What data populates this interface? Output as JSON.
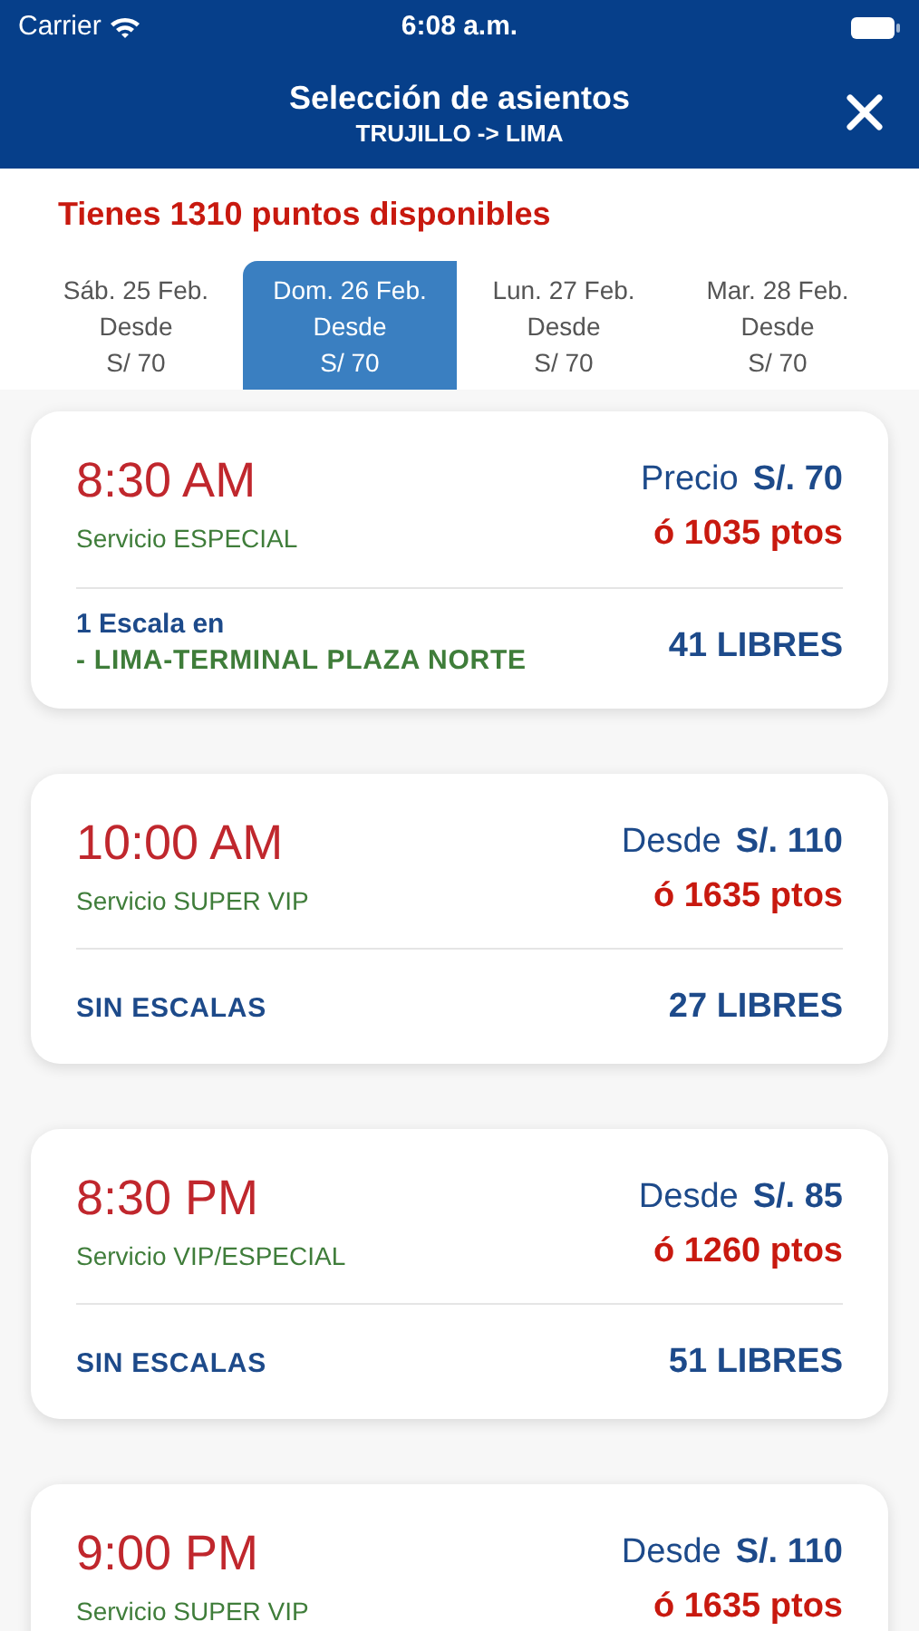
{
  "status_bar": {
    "carrier": "Carrier",
    "time": "6:08 a.m."
  },
  "header": {
    "title": "Selección de asientos",
    "route": "TRUJILLO -> LIMA"
  },
  "points_notice": "Tienes 1310 puntos disponibles",
  "dates": [
    {
      "day": "Sáb. 25 Feb.",
      "from": "Desde",
      "price": "S/ 70",
      "selected": false
    },
    {
      "day": "Dom. 26 Feb.",
      "from": "Desde",
      "price": "S/ 70",
      "selected": true
    },
    {
      "day": "Lun. 27 Feb.",
      "from": "Desde",
      "price": "S/ 70",
      "selected": false
    },
    {
      "day": "Mar. 28 Feb.",
      "from": "Desde",
      "price": "S/ 70",
      "selected": false
    }
  ],
  "trips": [
    {
      "time": "8:30 AM",
      "service": "Servicio ESPECIAL",
      "price_label": "Precio",
      "price": "S/. 70",
      "points": "ó 1035 ptos",
      "stops": {
        "kind": "stop",
        "label": "1 Escala en",
        "place": "- LIMA-TERMINAL PLAZA NORTE"
      },
      "seats": "41 LIBRES"
    },
    {
      "time": "10:00 AM",
      "service": "Servicio SUPER VIP",
      "price_label": "Desde",
      "price": "S/. 110",
      "points": "ó 1635 ptos",
      "stops": {
        "kind": "direct",
        "label": "SIN ESCALAS"
      },
      "seats": "27 LIBRES"
    },
    {
      "time": "8:30 PM",
      "service": "Servicio VIP/ESPECIAL",
      "price_label": "Desde",
      "price": "S/. 85",
      "points": "ó 1260 ptos",
      "stops": {
        "kind": "direct",
        "label": "SIN ESCALAS"
      },
      "seats": "51 LIBRES"
    },
    {
      "time": "9:00 PM",
      "service": "Servicio SUPER VIP",
      "price_label": "Desde",
      "price": "S/. 110",
      "points": "ó 1635 ptos"
    }
  ]
}
